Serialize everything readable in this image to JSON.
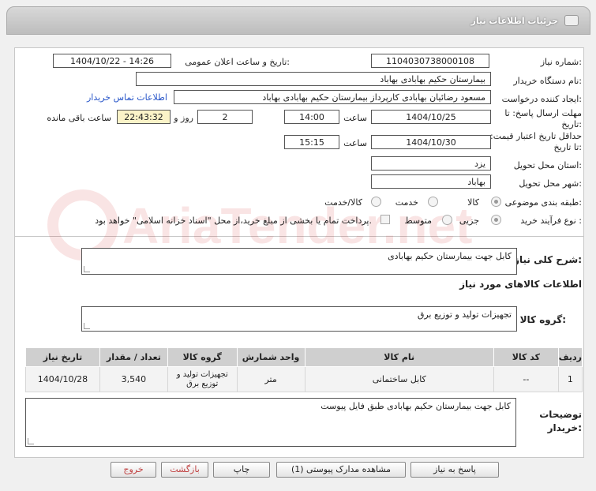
{
  "window": {
    "title": "جزئیات اطلاعات نیاز"
  },
  "fields": {
    "need_number_label": "شماره نیاز:",
    "need_number": "1104030738000108",
    "announce_label": "تاریخ و ساعت اعلان عمومی:",
    "announce_value": "1404/10/22 - 14:26",
    "buyer_org_label": "نام دستگاه خریدار:",
    "buyer_org": "بیمارستان حکیم بهابادی بهاباد",
    "creator_label": "ایجاد کننده درخواست:",
    "creator": "مسعود رضائیان بهابادی کارپرداز بیمارستان حکیم بهابادی بهاباد",
    "contact_link": "اطلاعات تماس خریدار",
    "deadline_label": "مهلت ارسال پاسخ: تا تاریخ:",
    "deadline_date": "1404/10/25",
    "time_label": "ساعت",
    "deadline_time": "14:00",
    "days": "2",
    "days_label": "روز و",
    "remaining": "22:43:32",
    "remaining_label": "ساعت باقی مانده",
    "validity_label": "حداقل تاریخ اعتبار قیمت: تا تاریخ:",
    "validity_date": "1404/10/30",
    "validity_time": "15:15",
    "province_label": "استان محل تحویل:",
    "province": "یزد",
    "city_label": "شهر محل تحویل:",
    "city": "بهاباد",
    "category_label": "طبقه بندی موضوعی:",
    "category_options": [
      "کالا",
      "خدمت",
      "کالا/خدمت"
    ],
    "process_label": "نوع فرآیند خرید :",
    "process_options": [
      "جزیی",
      "متوسط"
    ],
    "payment_note": "پرداخت تمام یا بخشی از مبلغ خرید،از محل \"اسناد خزانه اسلامی\" خواهد بود."
  },
  "need_summary": {
    "label": "شرح کلی نیاز:",
    "text": "کابل جهت بیمارستان حکیم بهابادی"
  },
  "goods_info_title": "اطلاعات کالاهای مورد نیاز",
  "goods_group": {
    "label": "گروه کالا:",
    "text": "تجهیزات تولید و توزیع برق"
  },
  "table": {
    "headers": [
      "ردیف",
      "کد کالا",
      "نام کالا",
      "واحد شمارش",
      "گروه کالا",
      "تعداد / مقدار",
      "تاریخ نیاز"
    ],
    "rows": [
      [
        "1",
        "--",
        "کابل ساختمانی",
        "متر",
        "تجهیزات تولید و توزیع برق",
        "3,540",
        "1404/10/28"
      ]
    ]
  },
  "buyer_notes": {
    "label": "توضیحات خریدار:",
    "text": "کابل جهت بیمارستان حکیم بهابادی طبق فایل پیوست"
  },
  "buttons": {
    "reply": "پاسخ به نیاز",
    "attachments": "مشاهده مدارک پیوستی (1)",
    "print": "چاپ",
    "back": "بازگشت",
    "exit": "خروج"
  },
  "watermark_text": "AriaTender.net"
}
